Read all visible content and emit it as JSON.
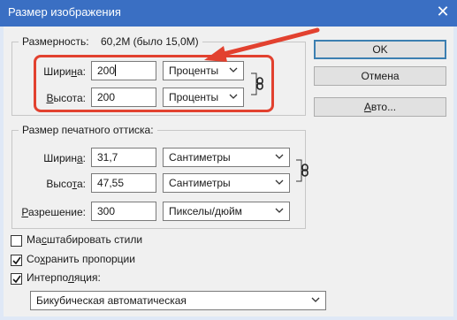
{
  "window": {
    "title": "Размер изображения",
    "close_glyph": "✕"
  },
  "pixel_dimensions": {
    "label": "Размерность:",
    "value": "60,2M (было 15,0M)",
    "width_label": "Ширина:",
    "width_value": "200",
    "width_unit": "Проценты",
    "height_label": "Высота:",
    "height_value": "200",
    "height_unit": "Проценты"
  },
  "print_size": {
    "legend": "Размер печатного оттиска:",
    "width_label": "Ширина:",
    "width_value": "31,7",
    "width_unit": "Сантиметры",
    "height_label": "Высота:",
    "height_value": "47,55",
    "height_unit": "Сантиметры",
    "resolution_label": "Разрешение:",
    "resolution_value": "300",
    "resolution_unit": "Пикселы/дюйм"
  },
  "options": {
    "scale_styles": {
      "label": "Масштабировать стили",
      "checked": false
    },
    "constrain": {
      "label": "Сохранить пропорции",
      "checked": true
    },
    "resample": {
      "label": "Интерполяция:",
      "checked": true
    },
    "resample_method": "Бикубическая автоматическая"
  },
  "buttons": {
    "ok": "OK",
    "cancel": "Отмена",
    "auto": "Авто..."
  },
  "colors": {
    "title_bar": "#3a6fc3",
    "annotation": "#e2412f",
    "dialog_bg": "#f0f0f0"
  },
  "icons": [
    "close-icon",
    "chevron-down-icon",
    "chain-link-icon",
    "checkmark-icon",
    "arrow-annotation"
  ]
}
